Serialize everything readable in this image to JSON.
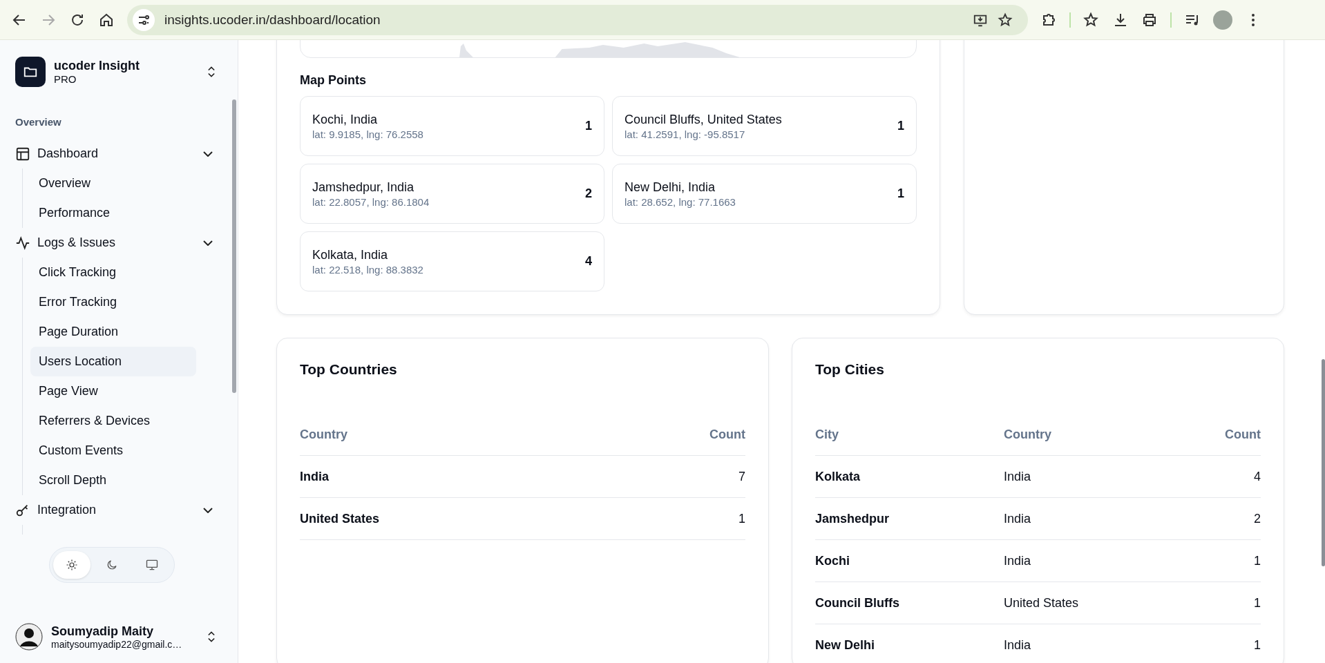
{
  "browser": {
    "url": "insights.ucoder.in/dashboard/location",
    "forward_disabled": true
  },
  "sidebar": {
    "app_name": "ucoder Insight",
    "plan": "PRO",
    "section_label": "Overview",
    "groups": [
      {
        "label": "Dashboard",
        "expanded": true,
        "children": [
          {
            "label": "Overview",
            "selected": false
          },
          {
            "label": "Performance",
            "selected": false
          }
        ]
      },
      {
        "label": "Logs & Issues",
        "expanded": true,
        "children": [
          {
            "label": "Click Tracking",
            "selected": false
          },
          {
            "label": "Error Tracking",
            "selected": false
          },
          {
            "label": "Page Duration",
            "selected": false
          },
          {
            "label": "Users Location",
            "selected": true
          },
          {
            "label": "Page View",
            "selected": false
          },
          {
            "label": "Referrers & Devices",
            "selected": false
          },
          {
            "label": "Custom Events",
            "selected": false
          },
          {
            "label": "Scroll Depth",
            "selected": false
          }
        ]
      },
      {
        "label": "Integration",
        "expanded": true
      }
    ],
    "theme_options": [
      {
        "kind": "light",
        "selected": true
      },
      {
        "kind": "dark",
        "selected": false
      },
      {
        "kind": "system",
        "selected": false
      }
    ],
    "user": {
      "name": "Soumyadip Maity",
      "email": "maitysoumyadip22@gmail.c…"
    }
  },
  "map_points": {
    "title": "Map Points",
    "points": [
      {
        "place": "Kochi, India",
        "coords": "lat: 9.9185, lng: 76.2558",
        "count": "1"
      },
      {
        "place": "Council Bluffs, United States",
        "coords": "lat: 41.2591, lng: -95.8517",
        "count": "1"
      },
      {
        "place": "Jamshedpur, India",
        "coords": "lat: 22.8057, lng: 86.1804",
        "count": "2"
      },
      {
        "place": "New Delhi, India",
        "coords": "lat: 28.652, lng: 77.1663",
        "count": "1"
      },
      {
        "place": "Kolkata, India",
        "coords": "lat: 22.518, lng: 88.3832",
        "count": "4"
      }
    ]
  },
  "top_countries": {
    "title": "Top Countries",
    "columns": [
      "Country",
      "Count"
    ],
    "rows": [
      [
        "India",
        "7"
      ],
      [
        "United States",
        "1"
      ]
    ]
  },
  "top_cities": {
    "title": "Top Cities",
    "columns": [
      "City",
      "Country",
      "Count"
    ],
    "rows": [
      [
        "Kolkata",
        "India",
        "4"
      ],
      [
        "Jamshedpur",
        "India",
        "2"
      ],
      [
        "Kochi",
        "India",
        "1"
      ],
      [
        "Council Bluffs",
        "United States",
        "1"
      ],
      [
        "New Delhi",
        "India",
        "1"
      ]
    ]
  }
}
